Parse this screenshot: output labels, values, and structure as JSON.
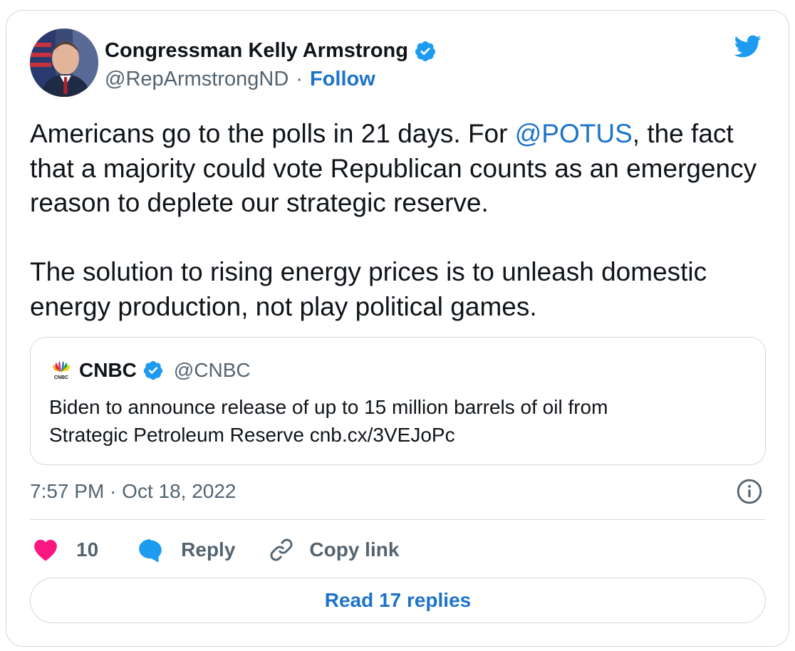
{
  "author": {
    "display_name": "Congressman Kelly Armstrong",
    "handle": "@RepArmstrongND",
    "separator": "·",
    "follow_label": "Follow",
    "verified_icon": "verified-badge-icon"
  },
  "tweet": {
    "paragraph1": {
      "before": "Americans go to the polls in 21 days. For ",
      "mention": "@POTUS",
      "after": ", the fact that a majority could vote Republican counts as an emergency reason to deplete our strategic reserve."
    },
    "paragraph2": "The solution to rising energy prices is to unleash domestic energy production, not play political games."
  },
  "quoted_tweet": {
    "name": "CNBC",
    "handle": "@CNBC",
    "text_line1": "Biden to announce release of up to 15 million barrels of oil from",
    "text_line2": "Strategic Petroleum Reserve cnb.cx/3VEJoPc"
  },
  "timestamp": "7:57 PM · Oct 18, 2022",
  "actions": {
    "like_count": "10",
    "reply_label": "Reply",
    "copy_link_label": "Copy link"
  },
  "read_replies_label": "Read 17 replies",
  "colors": {
    "accent": "#1d73c9",
    "verified": "#1d9bf0",
    "like": "#f91880",
    "muted": "#536471",
    "border": "#cfd9de"
  },
  "icons": [
    "twitter-bird-icon",
    "info-icon",
    "heart-icon",
    "reply-bubble-icon",
    "link-icon",
    "cnbc-peacock-icon"
  ]
}
